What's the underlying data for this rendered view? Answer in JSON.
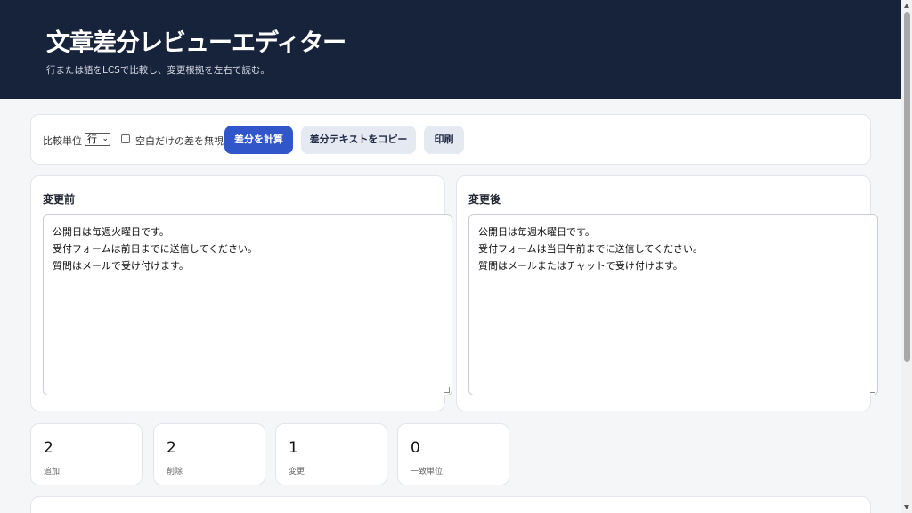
{
  "header": {
    "title": "文章差分レビューエディター",
    "subtitle": "行または語をLCSで比較し、変更根拠を左右で読む。"
  },
  "toolbar": {
    "unit_label": "比較単位",
    "unit_selected": "行",
    "ignore_whitespace_label": "空白だけの差を無視",
    "ignore_whitespace_checked": false,
    "compute_label": "差分を計算",
    "copy_label": "差分テキストをコピー",
    "print_label": "印刷"
  },
  "before": {
    "title": "変更前",
    "lines": [
      "公開日は毎週火曜日です。",
      "受付フォームは前日までに送信してください。",
      "質問はメールで受け付けます。"
    ]
  },
  "after": {
    "title": "変更後",
    "lines": [
      "公開日は毎週水曜日です。",
      "受付フォームは当日午前までに送信してください。",
      "質問はメールまたはチャットで受け付けます。"
    ]
  },
  "stats": [
    {
      "value": "2",
      "label": "追加"
    },
    {
      "value": "2",
      "label": "削除"
    },
    {
      "value": "1",
      "label": "変更"
    },
    {
      "value": "0",
      "label": "一致単位"
    }
  ],
  "colors": {
    "header_bg": "#17223b",
    "primary": "#3056c9",
    "secondary_btn": "#e5e9f2"
  }
}
